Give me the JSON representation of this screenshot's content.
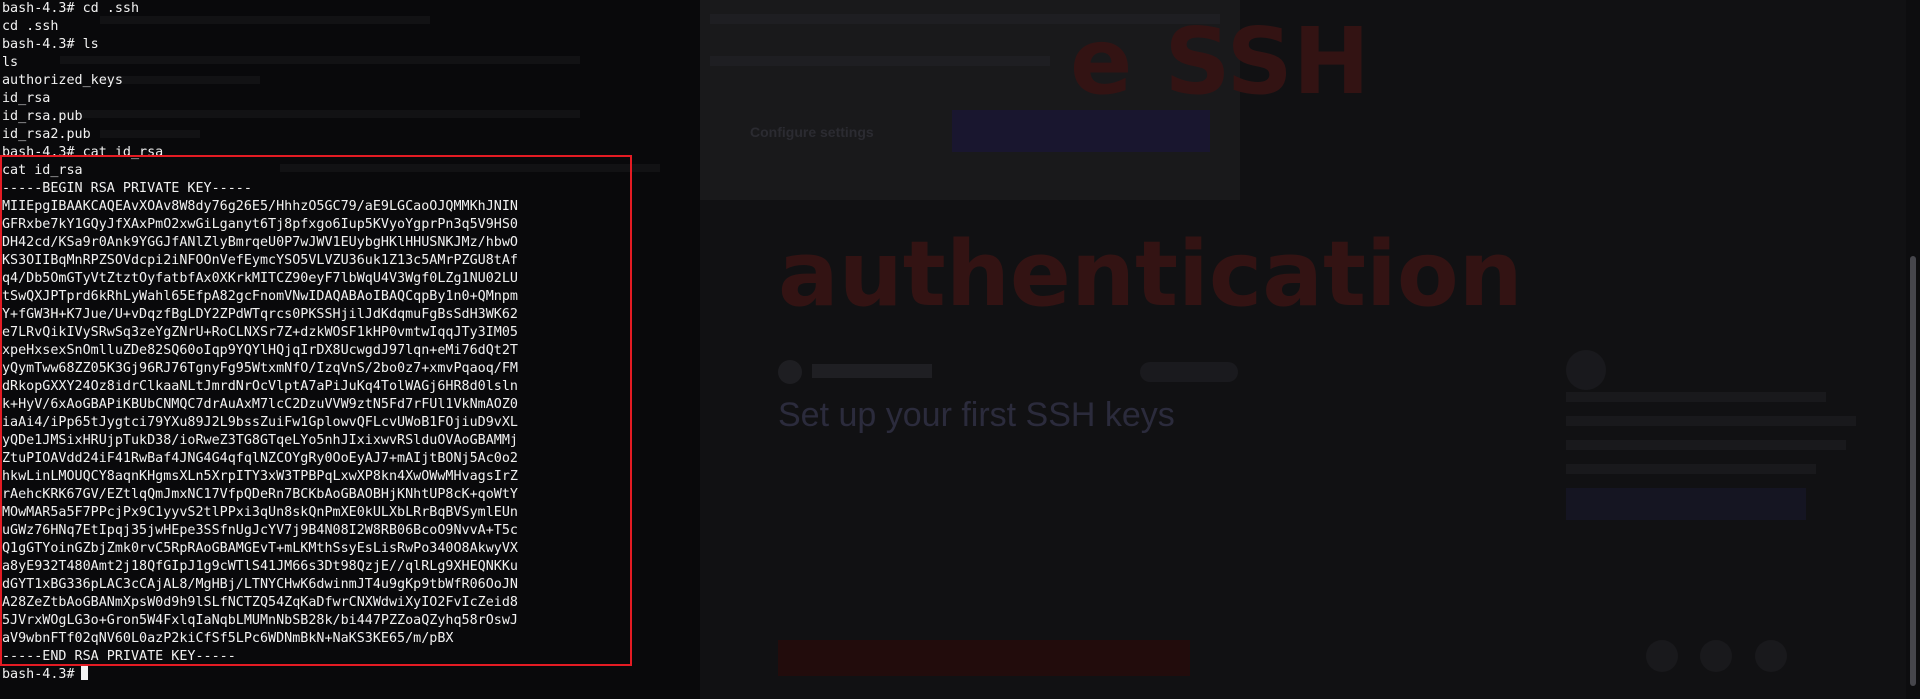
{
  "terminal": {
    "prompt": "bash-4.3#",
    "lines": [
      "bash-4.3# cd .ssh",
      "cd .ssh",
      "bash-4.3# ls",
      "ls",
      "authorized_keys",
      "id_rsa",
      "id_rsa.pub",
      "id_rsa2.pub",
      "bash-4.3# cat id_rsa",
      "cat id_rsa",
      "-----BEGIN RSA PRIVATE KEY-----",
      "MIIEpgIBAAKCAQEAvXOAv8W8dy76g26E5/HhhzO5GC79/aE9LGCaoOJQMMKhJNIN",
      "GFRxbe7kY1GQyJfXAxPmO2xwGiLganyt6Tj8pfxgo6Iup5KVyoYgprPn3q5V9HS0",
      "DH42cd/KSa9r0Ank9YGGJfANlZlyBmrqeU0P7wJWV1EUybgHKlHHUSNKJMz/hbwO",
      "KS3OIIBqMnRPZSOVdcpi2iNFOOnVefEymcYSO5VLVZU36uk1Z13c5AMrPZGU8tAf",
      "q4/Db5OmGTyVtZtztOyfatbfAx0XKrkMITCZ90eyF7lbWqU4V3Wgf0LZg1NU02LU",
      "tSwQXJPTprd6kRhLyWahl65EfpA82gcFnomVNwIDAQABAoIBAQCqpBy1n0+QMnpm",
      "Y+fGW3H+K7Jue/U+vDqzfBgLDY2ZPdWTqrcs0PKSSHjilJdKdqmuFgBsSdH3WK62",
      "e7LRvQikIVySRwSq3zeYgZNrU+RoCLNXSr7Z+dzkWOSF1kHP0vmtwIqqJTy3IM05",
      "xpeHxsexSnOmlluZDe82SQ60oIqp9YQYlHQjqIrDX8UcwgdJ97lqn+eMi76dQt2T",
      "yQymTww68ZZ05K3Gj96RJ76TgnyFg95WtxmNfO/IzqVnS/2bo0z7+xmvPqaoq/FM",
      "dRkopGXXY24Oz8idrClkaaNLtJmrdNrOcVlptA7aPiJuKq4TolWAGj6HR8d0lsln",
      "k+HyV/6xAoGBAPiKBUbCNMQC7drAuAxM7lcC2DzuVVW9ztN5Fd7rFUl1VkNmAOZ0",
      "iaAi4/iPp65tJygtci79YXu89J2L9bssZuiFw1GplowvQFLcvUWoB1FOjiuD9vXL",
      "yQDe1JMSixHRUjpTukD38/ioRweZ3TG8GTqeLYo5nhJIxixwvRSlduOVAoGBAMMj",
      "ZtuPIOAVdd24iF41RwBaf4JNG4G4qfqlNZCOYgRy0OoEyAJ7+mAIjtBONj5Ac0o2",
      "hkwLinLMOUQCY8aqnKHgmsXLn5XrpITY3xW3TPBPqLxwXP8kn4XwOWwMHvagsIrZ",
      "rAehcKRK67GV/EZtlqQmJmxNC17VfpQDeRn7BCKbAoGBAOBHjKNhtUP8cK+qoWtY",
      "MOwMAR5a5F7PPcjPx9C1yyvS2tlPPxi3qUn8skQnPmXE0kULXbLRrBqBVSymlEUn",
      "uGWz76HNq7EtIpqj35jwHEpe3SSfnUgJcYV7j9B4N08I2W8RB06BcoO9NvvA+T5c",
      "Q1gGTYoinGZbjZmk0rvC5RpRAoGBAMGEvT+mLKMthSsyEsLisRwPo340O8AkwyVX",
      "a8yE932T480Amt2j18QfGIpJ1g9cWTlS41JM66s3Dt98QzjE//qlRLg9XHEQNKKu",
      "dGYT1xBG336pLAC3cCAjAL8/MgHBj/LTNYCHwK6dwinmJT4u9gKp9tbWfR06OoJN",
      "A28ZeZtbAoGBANmXpsW0d9h9lSLfNCTZQ54ZqKaDfwrCNXWdwiXyIO2FvIcZeid8",
      "5JVrxWOgLG3o+Gron5W4FxlqIaNqbLMUMnNbSB28k/bi447PZZoaQZyhq58rOswJ",
      "aV9wbnFTf02qNV60L0azP2kiCfSf5LPc6WDNmBkN+NaKS3KE65/m/pBX",
      "-----END RSA PRIVATE KEY-----"
    ]
  },
  "background_page": {
    "headline_1": "e SSH",
    "headline_2": "authentication",
    "article_title": "Set up your first SSH keys",
    "cookie_configure": "Configure settings",
    "colors": {
      "highlight": "#e41b23",
      "terminal_text": "#f2f2f2",
      "terminal_bg": "#050505"
    }
  }
}
